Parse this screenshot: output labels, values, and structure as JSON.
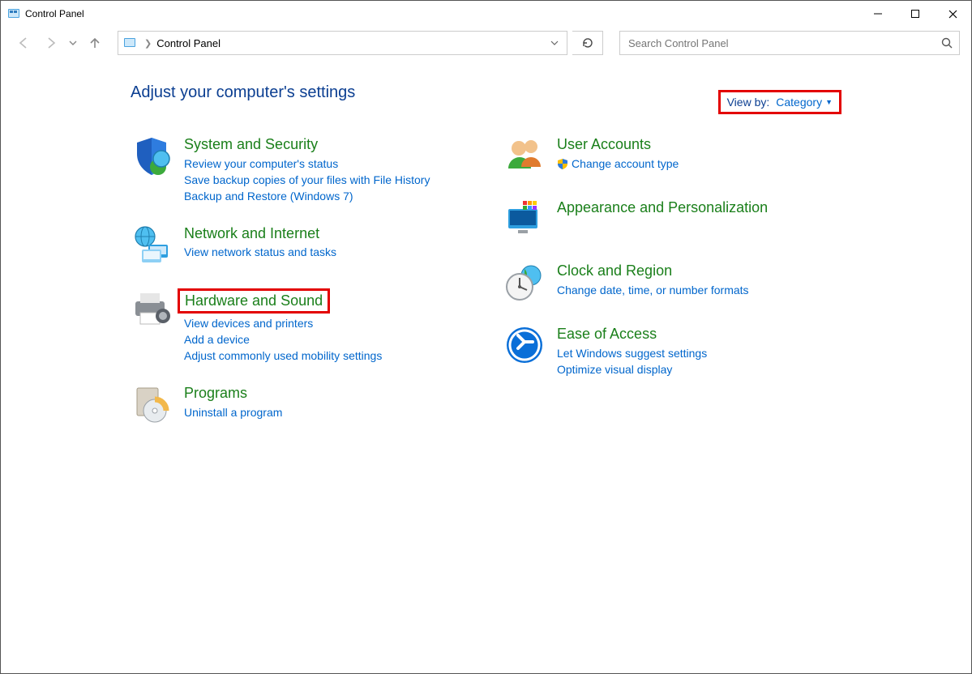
{
  "window": {
    "title": "Control Panel"
  },
  "toolbar": {
    "address": "Control Panel",
    "search_placeholder": "Search Control Panel"
  },
  "heading": "Adjust your computer's settings",
  "viewby": {
    "label": "View by:",
    "value": "Category"
  },
  "left": [
    {
      "id": "system-security",
      "title": "System and Security",
      "links": [
        "Review your computer's status",
        "Save backup copies of your files with File History",
        "Backup and Restore (Windows 7)"
      ]
    },
    {
      "id": "network-internet",
      "title": "Network and Internet",
      "links": [
        "View network status and tasks"
      ]
    },
    {
      "id": "hardware-sound",
      "title": "Hardware and Sound",
      "links": [
        "View devices and printers",
        "Add a device",
        "Adjust commonly used mobility settings"
      ]
    },
    {
      "id": "programs",
      "title": "Programs",
      "links": [
        "Uninstall a program"
      ]
    }
  ],
  "right": [
    {
      "id": "user-accounts",
      "title": "User Accounts",
      "links": [
        "Change account type"
      ],
      "shield": [
        true
      ]
    },
    {
      "id": "appearance",
      "title": "Appearance and Personalization",
      "links": []
    },
    {
      "id": "clock-region",
      "title": "Clock and Region",
      "links": [
        "Change date, time, or number formats"
      ]
    },
    {
      "id": "ease-of-access",
      "title": "Ease of Access",
      "links": [
        "Let Windows suggest settings",
        "Optimize visual display"
      ]
    }
  ]
}
